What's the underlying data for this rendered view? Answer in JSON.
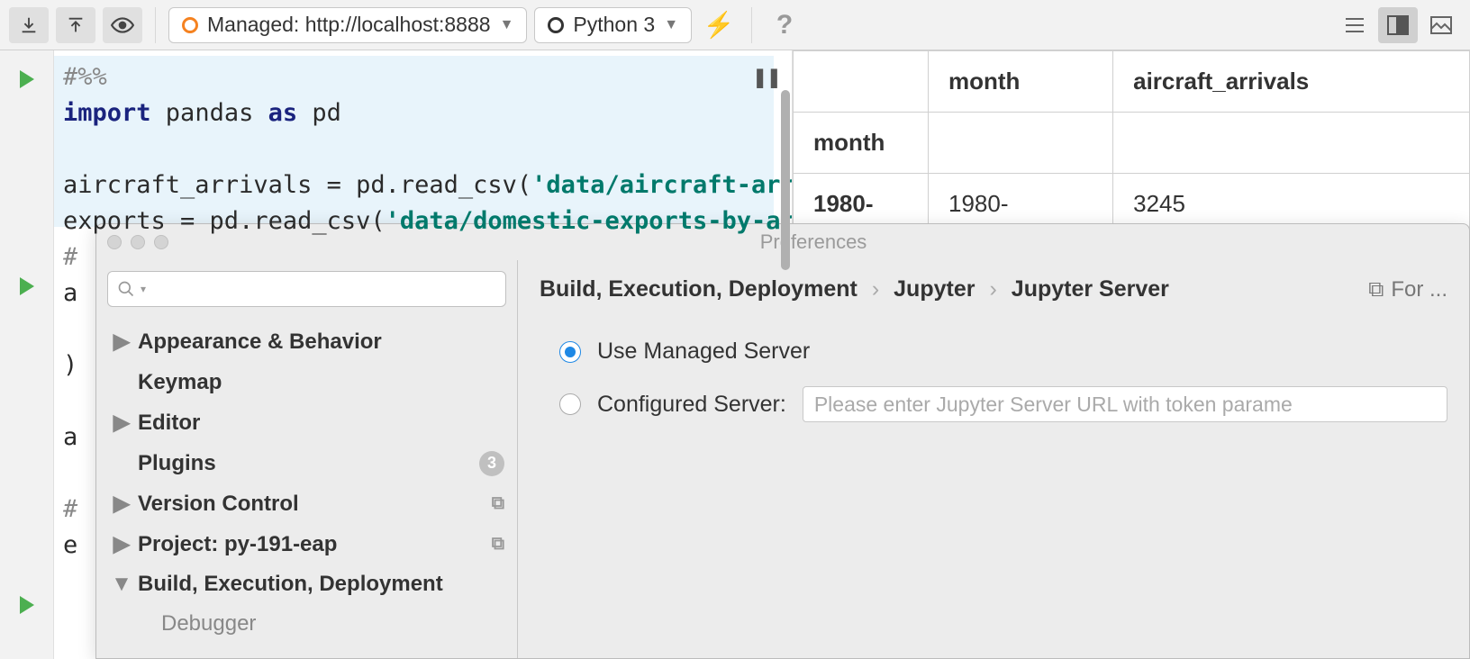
{
  "toolbar": {
    "managed_label": "Managed: http://localhost:8888",
    "kernel_label": "Python 3",
    "help": "?",
    "icons": {
      "down": "download-icon",
      "up": "upload-icon",
      "eye": "preview-icon",
      "bolt": "⚡",
      "lines": "view-list-icon",
      "cols": "view-columns-icon",
      "image": "view-image-icon"
    }
  },
  "code": {
    "l1": "#%%",
    "l2a": "import",
    "l2b": " pandas ",
    "l2c": "as",
    "l2d": " pd",
    "l3": "",
    "l4a": "aircraft_arrivals = pd.read_csv(",
    "l4b": "'data/aircraft-arri",
    "l5a": "exports = pd.read_csv(",
    "l5b": "'data/domestic-exports-by-are",
    "l6": "#",
    "l7": "a",
    "l8": "",
    "l9": ")",
    "l10": "",
    "l11": "a",
    "l12": "",
    "l13": "#",
    "l14": "e"
  },
  "table": {
    "h1": "month",
    "h2": "aircraft_arrivals",
    "r1": "month",
    "r2a": "1980-",
    "r2b": "1980-",
    "r2c": "3245"
  },
  "modal": {
    "title": "Preferences",
    "search_placeholder": "",
    "tree": {
      "appearance": "Appearance & Behavior",
      "keymap": "Keymap",
      "editor": "Editor",
      "plugins": "Plugins",
      "plugins_badge": "3",
      "vc": "Version Control",
      "project": "Project: py-191-eap",
      "build": "Build, Execution, Deployment",
      "debugger": "Debugger"
    },
    "breadcrumb": {
      "seg1": "Build, Execution, Deployment",
      "seg2": "Jupyter",
      "seg3": "Jupyter Server",
      "for": "For ..."
    },
    "radio1": "Use Managed Server",
    "radio2": "Configured Server:",
    "server_placeholder": "Please enter Jupyter Server URL with token parame"
  }
}
